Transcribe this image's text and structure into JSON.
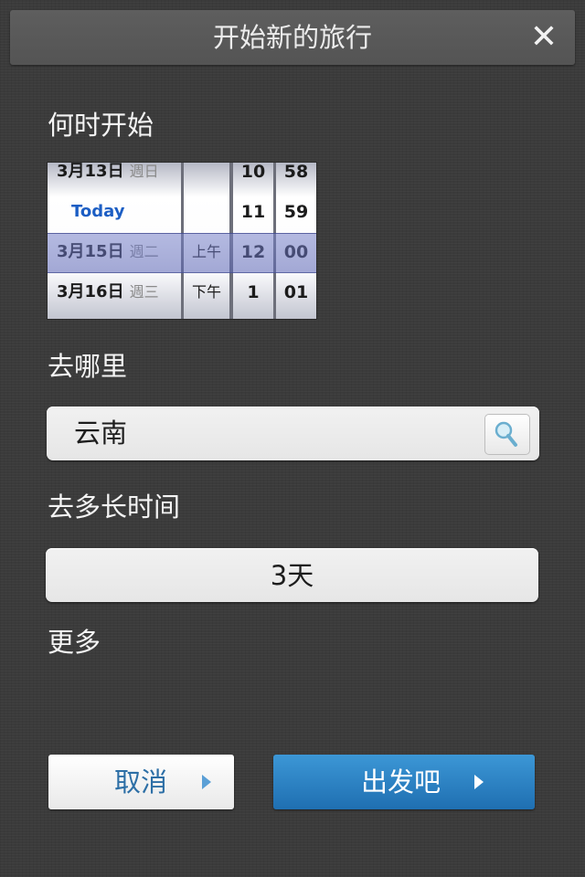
{
  "header": {
    "title": "开始新的旅行",
    "close_icon": "close-icon"
  },
  "when": {
    "label": "何时开始",
    "picker": {
      "dates": [
        {
          "date": "3月13日",
          "weekday": "週日"
        },
        {
          "date": "Today",
          "weekday": ""
        },
        {
          "date": "3月15日",
          "weekday": "週二"
        },
        {
          "date": "3月16日",
          "weekday": "週三"
        }
      ],
      "ampm": [
        "",
        "",
        "上午",
        "下午"
      ],
      "hours": [
        "10",
        "11",
        "12",
        "1"
      ],
      "minutes": [
        "58",
        "59",
        "00",
        "01"
      ],
      "selected_index": 2
    }
  },
  "where": {
    "label": "去哪里",
    "value": "云南",
    "search_icon": "search-icon"
  },
  "duration": {
    "label": "去多长时间",
    "value": "3天"
  },
  "more": {
    "label": "更多"
  },
  "actions": {
    "cancel_label": "取消",
    "go_label": "出发吧",
    "accent": "#2a82c4"
  }
}
